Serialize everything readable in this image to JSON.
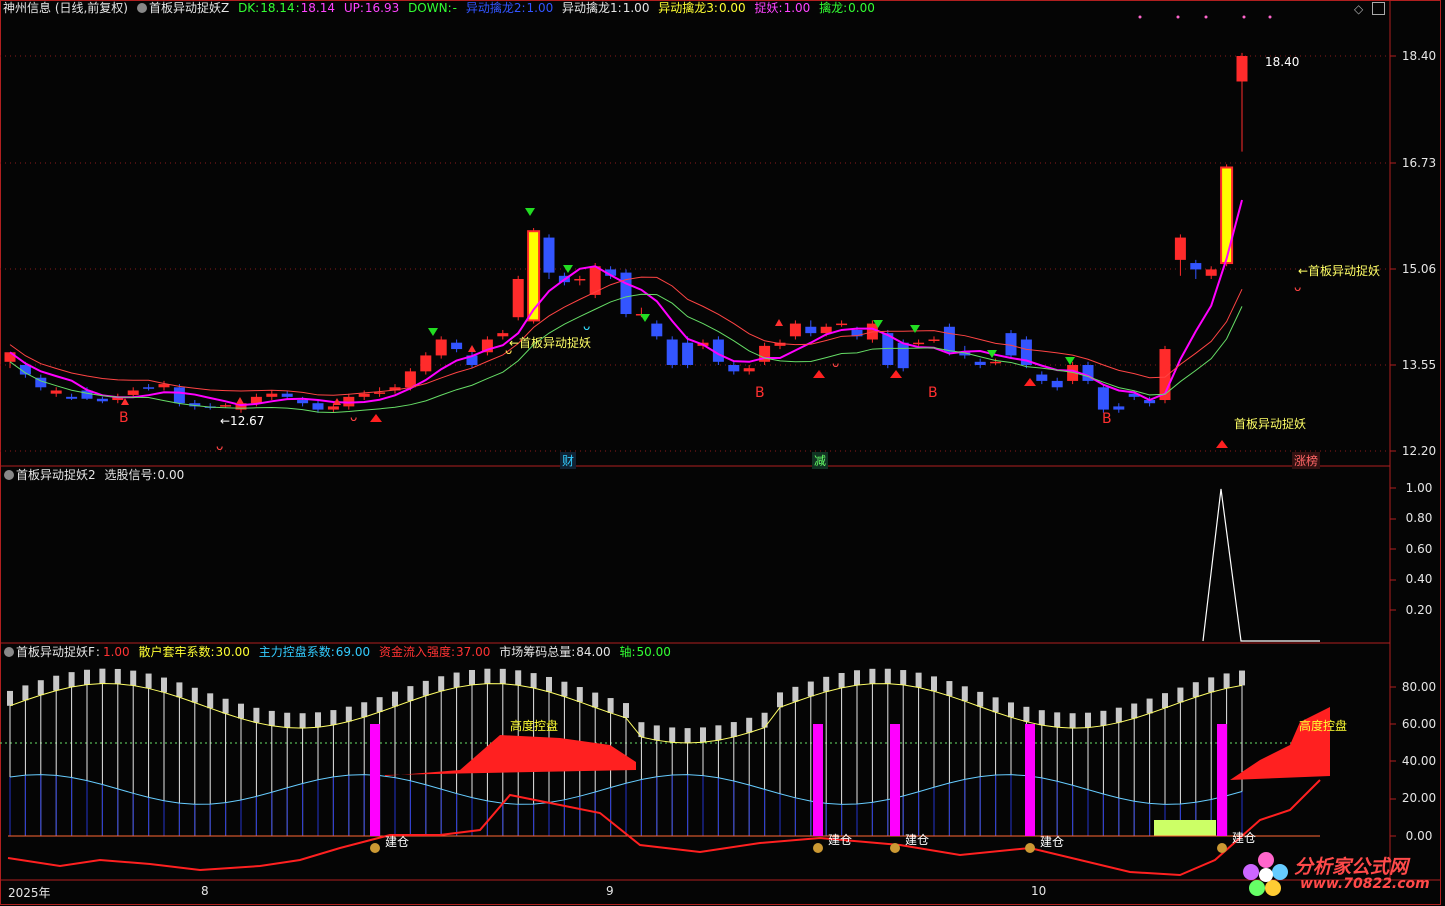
{
  "colors": {
    "up": "#ff2b2b",
    "down": "#3355ff",
    "magenta": "#ff00ff",
    "yellow": "#ffff00",
    "green": "#00e000",
    "grid": "#8b1a1a",
    "axis": "#b01f1f",
    "white": "#e6e6e6"
  },
  "panel1": {
    "title": "神州信息 (日线,前复权)",
    "indicator": "首板异动捉妖Z",
    "dk_label": "DK:",
    "dk": "18.14",
    "sep": ":",
    "dk2": "18.14",
    "up_label": "UP:",
    "up": "16.93",
    "down_label": "DOWN:",
    "down": "-",
    "yd2_label": "异动擒龙2:",
    "yd2": "1.00",
    "yd1_label": "异动擒龙1:",
    "yd1": "1.00",
    "yd3_label": "异动擒龙3:",
    "yd3": "0.00",
    "zy_label": "捉妖:",
    "zy": "1.00",
    "ql_label": "擒龙:",
    "ql": "0.00",
    "axis_ticks": [
      "18.40",
      "16.73",
      "15.06",
      "13.55",
      "12.20"
    ],
    "peak_label": "18.40",
    "low_label": "←12.67",
    "signal_label": "←首板异动捉妖",
    "signal_label2": "首板异动捉妖",
    "b_label": "B",
    "events": [
      {
        "text": "财",
        "color": "#33ccff"
      },
      {
        "text": "减",
        "color": "#66ff66"
      },
      {
        "text": "涨榜",
        "color": "#ff6666"
      }
    ],
    "candles": [
      [
        13.6,
        13.75,
        13.6,
        13.5
      ],
      [
        13.55,
        13.4,
        13.6,
        13.35
      ],
      [
        13.35,
        13.2,
        13.4,
        13.15
      ],
      [
        13.1,
        13.15,
        13.2,
        13.05
      ],
      [
        13.05,
        13.02,
        13.1,
        13.0
      ],
      [
        13.15,
        13.02,
        13.2,
        13.0
      ],
      [
        13.02,
        12.98,
        13.05,
        12.95
      ],
      [
        13.0,
        13.05,
        13.1,
        12.95
      ],
      [
        13.08,
        13.15,
        13.2,
        13.05
      ],
      [
        13.2,
        13.18,
        13.25,
        13.15
      ],
      [
        13.2,
        13.25,
        13.3,
        13.15
      ],
      [
        13.2,
        12.95,
        13.25,
        12.9
      ],
      [
        12.95,
        12.9,
        13.0,
        12.85
      ],
      [
        12.9,
        12.88,
        12.95,
        12.85
      ],
      [
        12.9,
        12.92,
        12.95,
        12.88
      ],
      [
        12.85,
        12.95,
        13.0,
        12.8
      ],
      [
        12.95,
        13.05,
        13.1,
        12.9
      ],
      [
        13.05,
        13.1,
        13.15,
        13.0
      ],
      [
        13.1,
        13.05,
        13.15,
        13.0
      ],
      [
        13.0,
        12.95,
        13.05,
        12.9
      ],
      [
        12.95,
        12.85,
        13.0,
        12.8
      ],
      [
        12.85,
        12.9,
        12.95,
        12.8
      ],
      [
        12.9,
        13.05,
        13.1,
        12.85
      ],
      [
        13.05,
        13.1,
        13.15,
        13.0
      ],
      [
        13.1,
        13.12,
        13.2,
        13.05
      ],
      [
        13.15,
        13.2,
        13.25,
        13.1
      ],
      [
        13.2,
        13.45,
        13.5,
        13.15
      ],
      [
        13.45,
        13.7,
        13.75,
        13.4
      ],
      [
        13.7,
        13.95,
        14.0,
        13.65
      ],
      [
        13.9,
        13.8,
        13.95,
        13.75
      ],
      [
        13.7,
        13.55,
        13.8,
        13.5
      ],
      [
        13.75,
        13.95,
        14.0,
        13.7
      ],
      [
        14.0,
        14.05,
        14.1,
        13.95
      ],
      [
        14.3,
        14.9,
        14.95,
        14.25
      ],
      [
        14.25,
        15.65,
        15.7,
        14.2
      ],
      [
        15.55,
        15.0,
        15.6,
        14.9
      ],
      [
        14.95,
        14.85,
        15.0,
        14.8
      ],
      [
        14.9,
        14.9,
        14.95,
        14.8
      ],
      [
        14.65,
        15.1,
        15.15,
        14.6
      ],
      [
        15.05,
        14.95,
        15.1,
        14.9
      ],
      [
        15.0,
        14.35,
        15.05,
        14.3
      ],
      [
        14.35,
        14.35,
        14.45,
        14.3
      ],
      [
        14.2,
        14.0,
        14.25,
        13.95
      ],
      [
        13.95,
        13.55,
        14.0,
        13.5
      ],
      [
        13.9,
        13.55,
        14.0,
        13.5
      ],
      [
        13.85,
        13.9,
        13.95,
        13.8
      ],
      [
        13.95,
        13.6,
        14.0,
        13.55
      ],
      [
        13.55,
        13.45,
        13.6,
        13.4
      ],
      [
        13.45,
        13.5,
        13.55,
        13.4
      ],
      [
        13.6,
        13.85,
        13.9,
        13.55
      ],
      [
        13.85,
        13.9,
        13.95,
        13.8
      ],
      [
        14.0,
        14.2,
        14.25,
        13.95
      ],
      [
        14.15,
        14.05,
        14.25,
        14.0
      ],
      [
        14.05,
        14.15,
        14.2,
        14.0
      ],
      [
        14.2,
        14.2,
        14.25,
        14.15
      ],
      [
        14.1,
        14.0,
        14.15,
        13.95
      ],
      [
        13.95,
        14.2,
        14.25,
        13.9
      ],
      [
        14.05,
        13.55,
        14.1,
        13.5
      ],
      [
        13.9,
        13.5,
        13.95,
        13.45
      ],
      [
        13.9,
        13.9,
        13.95,
        13.85
      ],
      [
        13.95,
        13.95,
        14.0,
        13.9
      ],
      [
        14.15,
        13.75,
        14.2,
        13.7
      ],
      [
        13.75,
        13.7,
        13.85,
        13.65
      ],
      [
        13.6,
        13.55,
        13.65,
        13.5
      ],
      [
        13.6,
        13.6,
        13.65,
        13.55
      ],
      [
        14.05,
        13.7,
        14.1,
        13.65
      ],
      [
        13.95,
        13.55,
        14.0,
        13.5
      ],
      [
        13.4,
        13.3,
        13.45,
        13.25
      ],
      [
        13.3,
        13.2,
        13.35,
        13.15
      ],
      [
        13.3,
        13.55,
        13.6,
        13.25
      ],
      [
        13.55,
        13.3,
        13.6,
        13.25
      ],
      [
        13.2,
        12.85,
        13.25,
        12.8
      ],
      [
        12.9,
        12.85,
        12.95,
        12.8
      ],
      [
        13.1,
        13.05,
        13.15,
        13.0
      ],
      [
        13.0,
        12.95,
        13.05,
        12.9
      ],
      [
        13.0,
        13.8,
        13.85,
        12.95
      ],
      [
        15.2,
        15.55,
        15.6,
        14.95
      ],
      [
        15.15,
        15.05,
        15.2,
        14.9
      ],
      [
        14.95,
        15.05,
        15.1,
        14.9
      ],
      [
        15.15,
        16.65,
        16.7,
        15.1
      ],
      [
        18.0,
        18.4,
        18.45,
        16.9
      ]
    ]
  },
  "panel2": {
    "title": "首板异动捉妖2",
    "sig_label": "选股信号:",
    "sig": "0.00",
    "axis_ticks": [
      "1.00",
      "0.80",
      "0.60",
      "0.40",
      "0.20"
    ]
  },
  "panel3": {
    "title": "首板异动捉妖F",
    "sep": ":",
    "f": "1.00",
    "s1_label": "散户套牢系数:",
    "s1": "30.00",
    "s2_label": "主力控盘系数:",
    "s2": "69.00",
    "s3_label": "资金流入强度:",
    "s3": "37.00",
    "s4_label": "市场筹码总量:",
    "s4": "84.00",
    "s5_label": "轴:",
    "s5": "50.00",
    "axis_ticks": [
      "80.00",
      "60.00",
      "40.00",
      "20.00",
      "0.00"
    ],
    "label_control": "高度控盘",
    "label_build": "建仓"
  },
  "timeline": {
    "year": "2025年",
    "m8": "8",
    "m9": "9",
    "m10": "10"
  },
  "logo": {
    "text1": "分析家公式网",
    "text2": "www.70822.com"
  },
  "window_icons": [
    "diamond-icon",
    "restore-icon"
  ]
}
